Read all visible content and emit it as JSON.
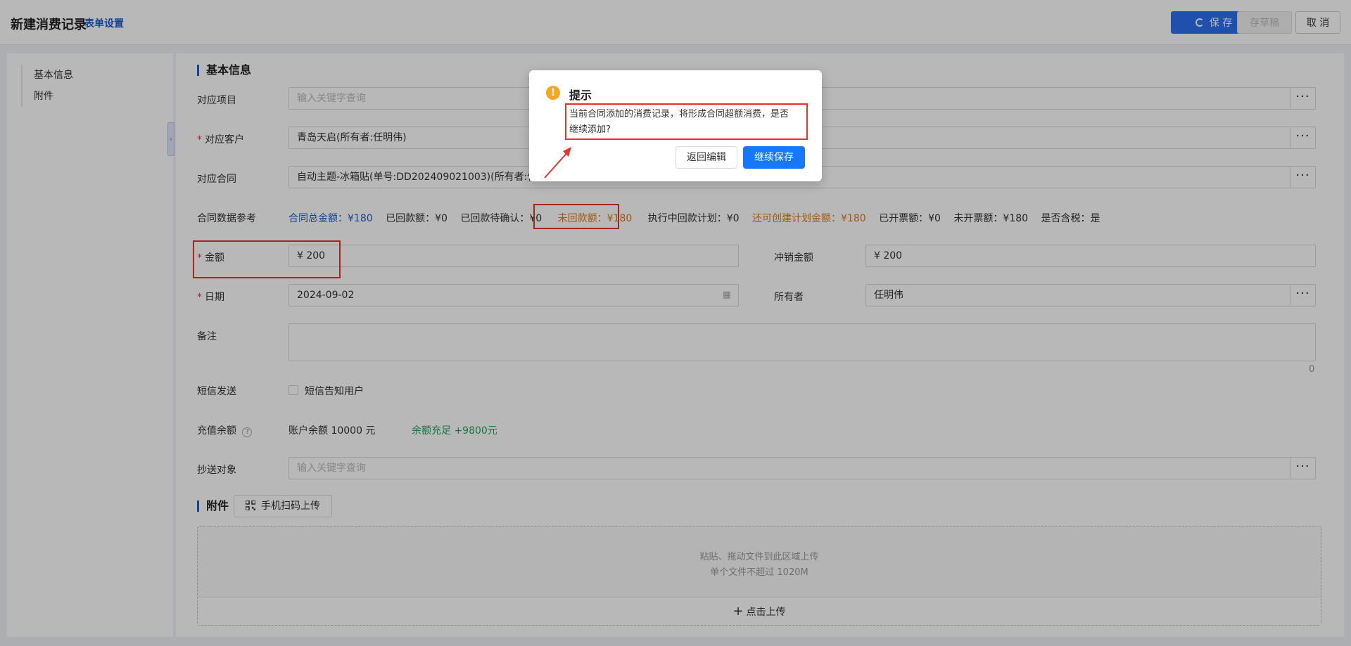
{
  "header": {
    "title": "新建消费记录",
    "form_settings": "表单设置",
    "save": "保 存",
    "draft": "存草稿",
    "cancel": "取 消"
  },
  "sidebar": {
    "items": [
      {
        "label": "基本信息"
      },
      {
        "label": "附件"
      }
    ]
  },
  "basic": {
    "section_title": "基本信息",
    "project": {
      "label": "对应项目",
      "placeholder": "输入关键字查询"
    },
    "customer": {
      "label": "对应客户",
      "value": "青岛天启(所有者:任明伟)"
    },
    "contract": {
      "label": "对应合同",
      "value": "自动主题-冰箱贴(单号:DD202409021003)(所有者:任明伟)"
    },
    "contract_ref": {
      "label": "合同数据参考",
      "total": "合同总金额：¥180",
      "received": "已回款额：¥0",
      "pending_confirm": "已回款待确认：¥0",
      "unreceived": "未回款额：¥180",
      "executing_plan": "执行中回款计划：¥0",
      "creatable_plan": "还可创建计划金额：¥180",
      "invoiced": "已开票额：¥0",
      "uninvoiced": "未开票额：¥180",
      "tax_included": "是否含税：是"
    },
    "amount": {
      "label": "金额",
      "value": "¥  200"
    },
    "offset_amount": {
      "label": "冲销金额",
      "value": "¥  200"
    },
    "date": {
      "label": "日期",
      "value": "2024-09-02"
    },
    "owner": {
      "label": "所有者",
      "value": "任明伟"
    },
    "remark": {
      "label": "备注",
      "count": "0"
    },
    "sms": {
      "label": "短信发送",
      "option": "短信告知用户"
    },
    "balance": {
      "label": "充值余额",
      "value": "账户余额 10000 元",
      "status": "余额充足 +9800元"
    },
    "cc": {
      "label": "抄送对象",
      "placeholder": "输入关键字查询"
    }
  },
  "attachment": {
    "section_title": "附件",
    "scan_upload": "手机扫码上传",
    "hint1": "粘贴、拖动文件到此区域上传",
    "hint2": "单个文件不超过 1020M",
    "click_upload": "点击上传"
  },
  "dialog": {
    "title": "提示",
    "message": "当前合同添加的消费记录，将形成合同超额消费，是否继续添加?",
    "back_edit": "返回编辑",
    "continue_save": "继续保存"
  },
  "colors": {
    "primary": "#1a5fd0",
    "orange": "#e07b1a",
    "green": "#2aa060",
    "annotation_red": "#e5342c"
  }
}
